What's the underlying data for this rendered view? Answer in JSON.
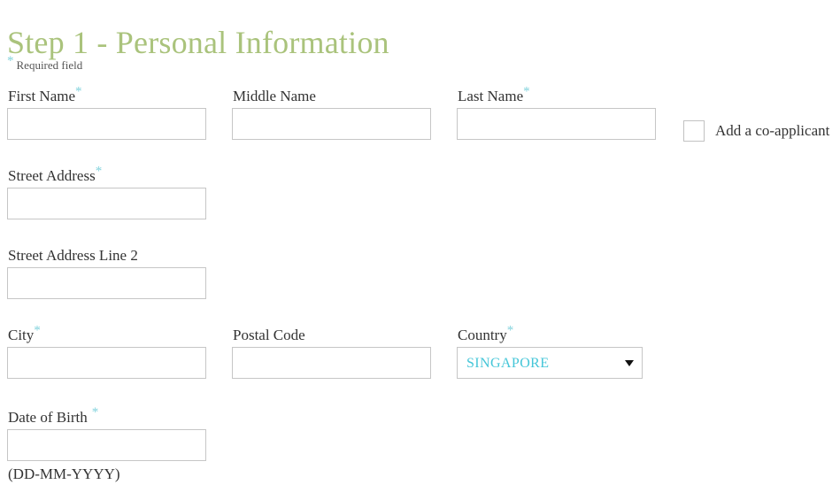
{
  "page": {
    "title": "Step 1 - Personal Information",
    "required_note": "Required field",
    "required_marker": "*",
    "title_color": "#aac37c",
    "required_marker_color": "#84d3dd",
    "label_color": "#333333",
    "input_border_color": "#c6c6c6",
    "select_value_color": "#45c6d8"
  },
  "fields": {
    "first_name": {
      "label": "First Name",
      "required": true,
      "value": "",
      "placeholder": ""
    },
    "middle_name": {
      "label": "Middle Name",
      "required": false,
      "value": "",
      "placeholder": ""
    },
    "last_name": {
      "label": "Last Name",
      "required": true,
      "value": "",
      "placeholder": ""
    },
    "street_address": {
      "label": "Street Address",
      "required": true,
      "value": "",
      "placeholder": ""
    },
    "street_address_2": {
      "label": "Street Address Line 2",
      "required": false,
      "value": "",
      "placeholder": ""
    },
    "city": {
      "label": "City",
      "required": true,
      "value": "",
      "placeholder": ""
    },
    "postal_code": {
      "label": "Postal Code",
      "required": false,
      "value": "",
      "placeholder": ""
    },
    "country": {
      "label": "Country",
      "required": true,
      "selected": "SINGAPORE",
      "arrow_icon": "chevron-down-icon"
    },
    "date_of_birth": {
      "label": "Date of Birth",
      "required": true,
      "value": "",
      "placeholder": "",
      "hint": "(DD-MM-YYYY)"
    }
  },
  "checkbox": {
    "label": "Add a co-applicant",
    "checked": false
  }
}
